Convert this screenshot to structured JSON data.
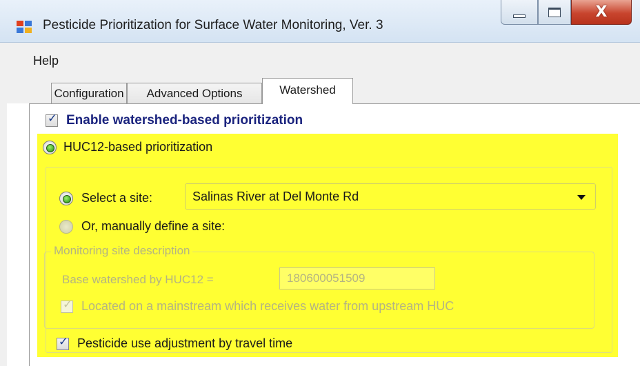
{
  "window": {
    "title": "Pesticide Prioritization for Surface Water Monitoring, Ver. 3",
    "close_glyph": "X"
  },
  "menu": {
    "items": [
      {
        "label": "Help"
      }
    ]
  },
  "tabs": [
    {
      "label": "Configuration",
      "active": false
    },
    {
      "label": "Advanced Options",
      "active": false
    },
    {
      "label": "Watershed",
      "active": true
    }
  ],
  "watershed": {
    "enable": {
      "label": "Enable watershed-based prioritization",
      "checked": true
    },
    "huc12": {
      "label": "HUC12-based prioritization",
      "selected": true
    },
    "select_site": {
      "label": "Select a site:",
      "selected": true,
      "dropdown_value": "Salinas River at Del Monte Rd"
    },
    "manual_site": {
      "label": "Or, manually define a site:",
      "selected": false
    },
    "monitoring_group": {
      "legend": "Monitoring site description",
      "base_label": "Base watershed by HUC12 =",
      "base_value": "180600051509",
      "mainstream": {
        "label": "Located on a mainstream which receives water from upstream HUC",
        "checked": true,
        "disabled": true
      }
    },
    "adjust": {
      "label": "Pesticide use adjustment by travel time",
      "checked": true
    }
  },
  "colors": {
    "highlight": "#ffff33",
    "enable_label": "#1a237e",
    "disabled_text": "#b4b482",
    "close_button": "#c8452e"
  },
  "icons": {
    "check": "✓"
  }
}
